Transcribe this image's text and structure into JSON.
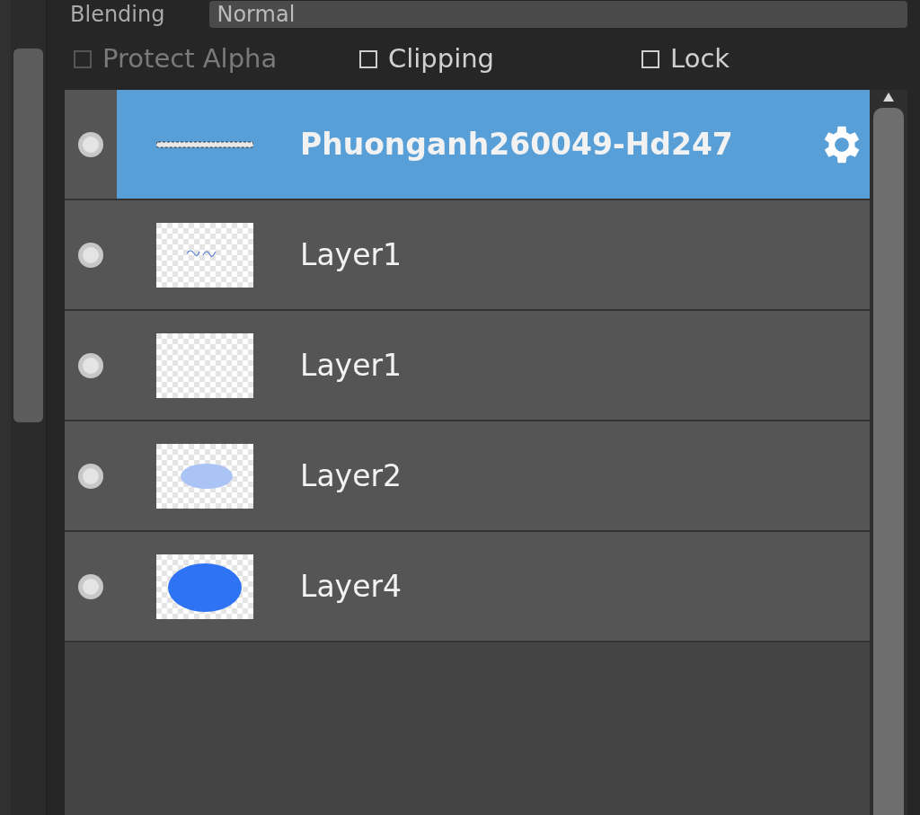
{
  "blending": {
    "label": "Blending",
    "value": "Normal"
  },
  "options": [
    {
      "label": "Protect Alpha",
      "checked": false,
      "disabled": true
    },
    {
      "label": "Clipping",
      "checked": false,
      "disabled": false
    },
    {
      "label": "Lock",
      "checked": false,
      "disabled": false
    }
  ],
  "layers": [
    {
      "name": "Phuonganh260049-Hd247",
      "selected": true,
      "kind": "line"
    },
    {
      "name": "Layer1",
      "selected": false,
      "kind": "scribble"
    },
    {
      "name": "Layer1",
      "selected": false,
      "kind": "empty"
    },
    {
      "name": "Layer2",
      "selected": false,
      "kind": "pale-blob"
    },
    {
      "name": "Layer4",
      "selected": false,
      "kind": "blob"
    }
  ]
}
